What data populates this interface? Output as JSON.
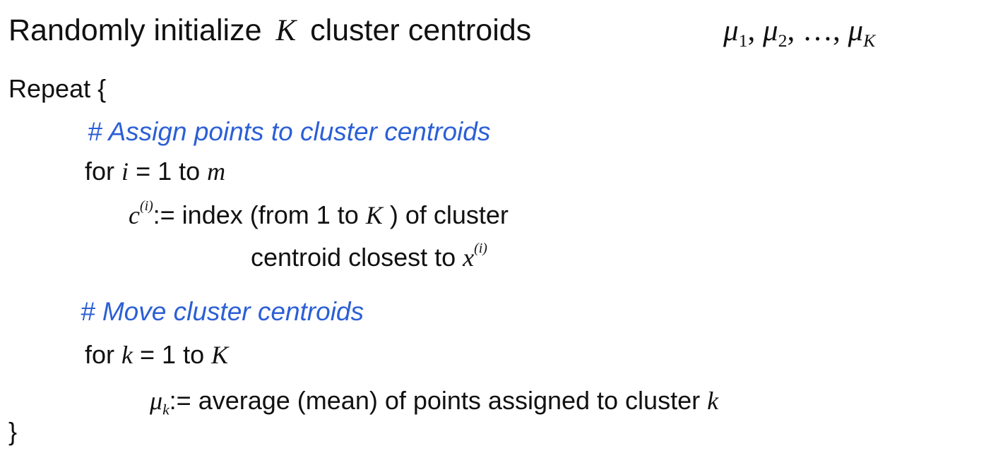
{
  "title": {
    "text": "Randomly initialize",
    "var": "K",
    "suffix": "cluster centroids",
    "mu_sym": "μ",
    "sub1": "1",
    "sub2": "2",
    "ellipsis": "…",
    "subK": "K",
    "comma": ","
  },
  "repeat_open": "Repeat {",
  "section1": {
    "comment": "# Assign points to cluster centroids",
    "for_kw": "for",
    "loop_var": "i",
    "range_mid": "= 1 to",
    "range_end": "m",
    "assign_var": "c",
    "assign_sup": "(i)",
    "assign_text": ":= index (from 1 to",
    "assign_K": "K",
    "assign_tail": ") of cluster",
    "cont_text": "centroid closest to",
    "cont_var": "x",
    "cont_sup": "(i)"
  },
  "section2": {
    "comment": "# Move cluster centroids",
    "for_kw": "for",
    "loop_var": "k",
    "range_mid": "= 1 to",
    "range_end": "K",
    "mu_sym": "μ",
    "mu_sub": "k",
    "assign_text": ":= average (mean) of points assigned to cluster",
    "assign_end": "k"
  },
  "repeat_close": "}"
}
